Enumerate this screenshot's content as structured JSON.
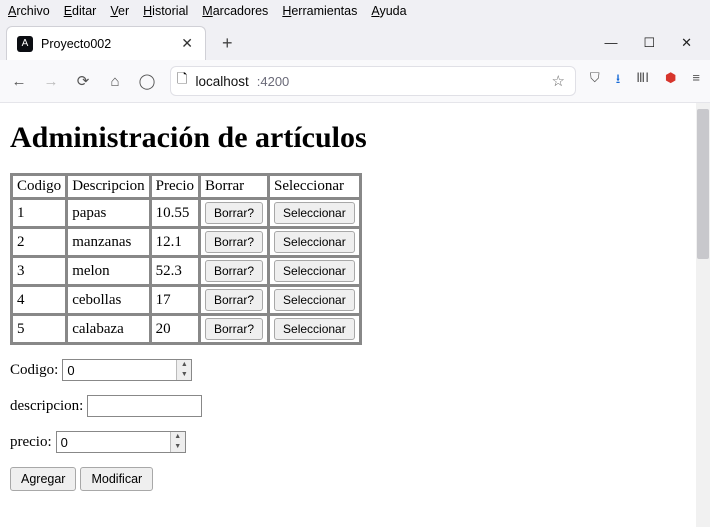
{
  "browser": {
    "menus": [
      "Archivo",
      "Editar",
      "Ver",
      "Historial",
      "Marcadores",
      "Herramientas",
      "Ayuda"
    ],
    "tab_title": "Proyecto002",
    "favicon_letter": "A",
    "url_host": "localhost",
    "url_port": ":4200"
  },
  "page": {
    "heading": "Administración de artículos",
    "table": {
      "headers": [
        "Codigo",
        "Descripcion",
        "Precio",
        "Borrar",
        "Seleccionar"
      ],
      "rows": [
        {
          "codigo": "1",
          "descripcion": "papas",
          "precio": "10.55"
        },
        {
          "codigo": "2",
          "descripcion": "manzanas",
          "precio": "12.1"
        },
        {
          "codigo": "3",
          "descripcion": "melon",
          "precio": "52.3"
        },
        {
          "codigo": "4",
          "descripcion": "cebollas",
          "precio": "17"
        },
        {
          "codigo": "5",
          "descripcion": "calabaza",
          "precio": "20"
        }
      ],
      "borrar_label": "Borrar?",
      "seleccionar_label": "Seleccionar"
    },
    "form": {
      "codigo_label": "Codigo:",
      "codigo_value": "0",
      "descripcion_label": "descripcion:",
      "descripcion_value": "",
      "precio_label": "precio:",
      "precio_value": "0",
      "agregar_label": "Agregar",
      "modificar_label": "Modificar"
    }
  }
}
